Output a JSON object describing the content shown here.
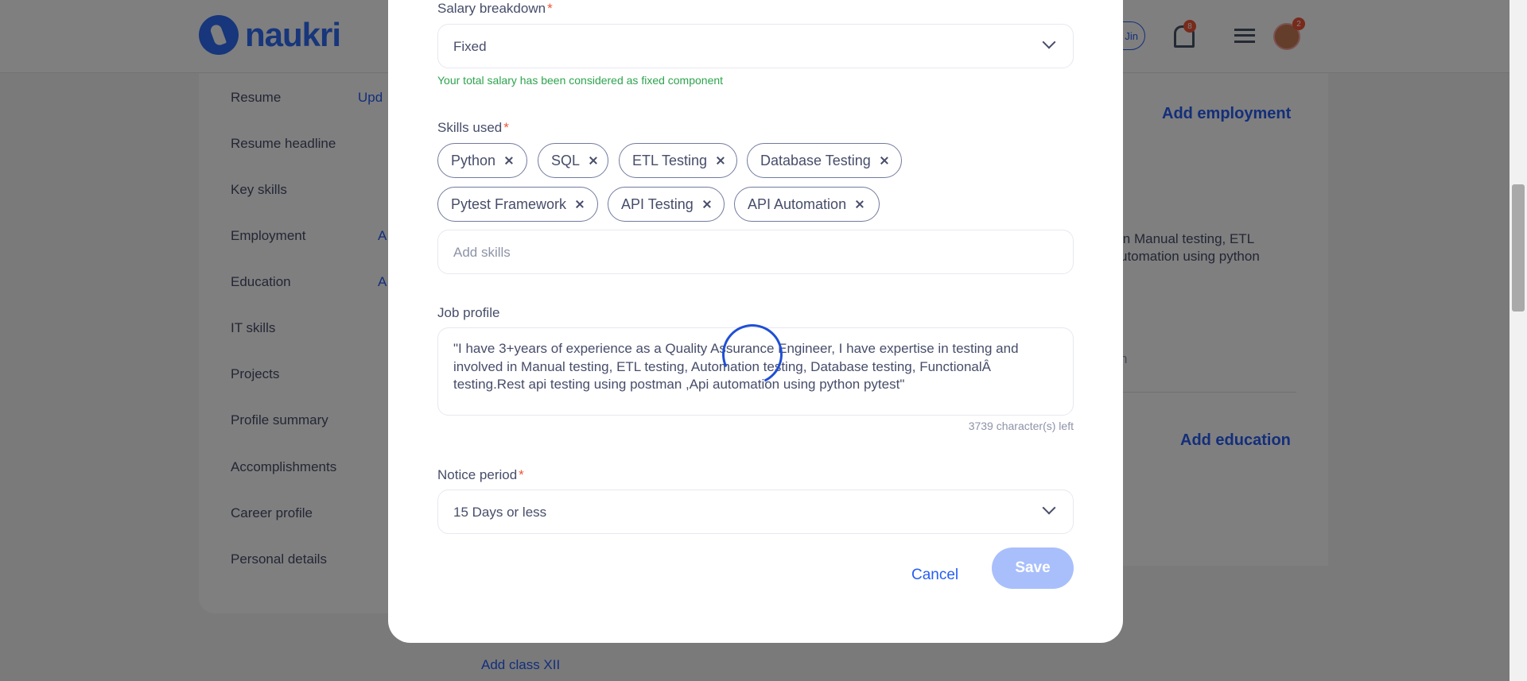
{
  "header": {
    "logo_text": "naukri",
    "pill_label": "Jin",
    "notification_count": "8",
    "avatar_badge_count": "2"
  },
  "sidebar": {
    "items": [
      {
        "label": "Resume"
      },
      {
        "label": "Resume headline"
      },
      {
        "label": "Key skills"
      },
      {
        "label": "Employment"
      },
      {
        "label": "Education"
      },
      {
        "label": "IT skills"
      },
      {
        "label": "Projects"
      },
      {
        "label": "Profile summary"
      },
      {
        "label": "Accomplishments"
      },
      {
        "label": "Career profile"
      },
      {
        "label": "Personal details"
      }
    ],
    "side_links": [
      "Upd",
      "A",
      "A"
    ]
  },
  "background_right": {
    "add_employment": "Add employment",
    "summary_line1": "in Manual testing, ETL",
    "summary_line2": "utomation using python",
    "faint_text": "n",
    "add_education": "Add education",
    "add_class_xii": "Add class XII"
  },
  "modal": {
    "salary_breakdown": {
      "label": "Salary breakdown",
      "value": "Fixed",
      "hint": "Your total salary has been considered as fixed component"
    },
    "skills_used": {
      "label": "Skills used",
      "chips": [
        "Python",
        "SQL",
        "ETL Testing",
        "Database Testing",
        "Pytest Framework",
        "API Testing",
        "API Automation"
      ],
      "placeholder": "Add skills"
    },
    "job_profile": {
      "label": "Job profile",
      "value": "\"I have 3+years of experience as a Quality Assurance Engineer, I have expertise in testing and involved in Manual testing, ETL testing, Automation testing, Database testing, FunctionalÂ testing.Rest api testing using postman ,Api automation using python pytest\"",
      "chars_left": "3739 character(s) left"
    },
    "notice_period": {
      "label": "Notice period",
      "value": "15 Days or less"
    },
    "required_marker": "*",
    "cancel_label": "Cancel",
    "save_label": "Save"
  },
  "colors": {
    "accent": "#275df5",
    "required": "#f05537",
    "hint_green": "#2da44e",
    "save_disabled": "#a8bffb"
  }
}
